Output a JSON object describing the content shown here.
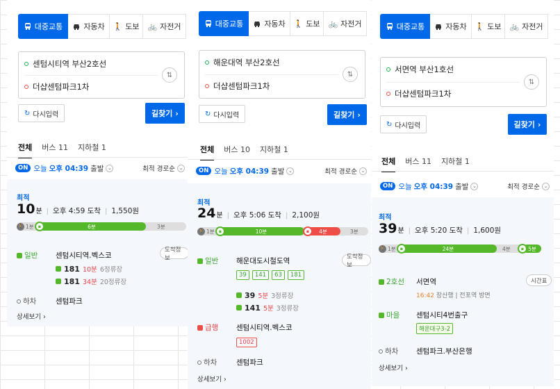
{
  "panels": [
    {
      "modes": [
        "대중교통",
        "자동차",
        "도보",
        "자전거"
      ],
      "start": "센텀시티역 부산2호선",
      "end": "더샵센텀파크1차",
      "reset": "다시입력",
      "go": "길찾기",
      "tabs": [
        "전체",
        "버스 11",
        "지하철 1"
      ],
      "on": "ON",
      "today": "오늘",
      "depart_time": "오후 04:39",
      "depart_suffix": "출발",
      "sort": "최적 경로순",
      "best": "최적",
      "minutes": "10",
      "unit": "분",
      "arrive": "오후 4:59 도착",
      "fare": "1,550원",
      "bar": {
        "walk1": "1분",
        "seg1": "6분",
        "walk2": "3분"
      },
      "steps": [
        {
          "tag": "일반",
          "station": "센텀시티역.벡스코",
          "btn": "도착정보"
        }
      ],
      "buses": [
        {
          "num": "181",
          "min": "10분",
          "stops": "6정류장"
        },
        {
          "num": "181",
          "min": "34분",
          "stops": "20정류장"
        }
      ],
      "alight_label": "하차",
      "alight_station": "센텀파크",
      "more": "상세보기"
    },
    {
      "modes": [
        "대중교통",
        "자동차",
        "도보",
        "자전거"
      ],
      "start": "해운대역 부산2호선",
      "end": "더샵센텀파크1차",
      "reset": "다시입력",
      "go": "길찾기",
      "tabs": [
        "전체",
        "버스 10",
        "지하철 1"
      ],
      "on": "ON",
      "today": "오늘",
      "depart_time": "오후 04:39",
      "depart_suffix": "출발",
      "sort": "최적 경로순",
      "best": "최적",
      "minutes": "24",
      "unit": "분",
      "arrive": "오후 5:06 도착",
      "fare": "2,100원",
      "bar": {
        "walk1": "1분",
        "seg1": "10분",
        "seg2": "4분",
        "walk2": "3분"
      },
      "steps": [
        {
          "tag": "일반",
          "station": "해운대도시철도역",
          "btn": "도착정보",
          "chips": [
            "39",
            "141",
            "63",
            "181"
          ]
        },
        {
          "tag": "급행",
          "station": "센텀시티역.벡스코",
          "chips": [
            "1002"
          ]
        }
      ],
      "buses": [
        {
          "num": "39",
          "min": "5분",
          "stops": "3정류장"
        },
        {
          "num": "141",
          "min": "5분",
          "stops": "3정류장"
        }
      ],
      "alight_label": "하차",
      "alight_station": "센텀파크",
      "more": "상세보기"
    },
    {
      "modes": [
        "대중교통",
        "자동차",
        "도보",
        "자전거"
      ],
      "start": "서면역 부산1호선",
      "end": "더샵센텀파크1차",
      "reset": "다시입력",
      "go": "길찾기",
      "tabs": [
        "전체",
        "버스 11",
        "지하철 1"
      ],
      "on": "ON",
      "today": "오늘",
      "depart_time": "오후 04:39",
      "depart_suffix": "출발",
      "sort": "최적 경로순",
      "best": "최적",
      "minutes": "39",
      "unit": "분",
      "arrive": "오후 5:20 도착",
      "fare": "1,600원",
      "bar": {
        "walk1": "1분",
        "seg1": "24분",
        "walk2": "4분",
        "seg2": "5분"
      },
      "steps": [
        {
          "tag": "2호선",
          "station": "서면역",
          "btn": "시간표",
          "note_time": "16:42",
          "note_rest": "장산행 | 전포역 방면"
        },
        {
          "tag": "마을",
          "station": "센텀시티4번출구",
          "chips": [
            "해운대구3-2"
          ]
        }
      ],
      "alight_label": "하차",
      "alight_station": "센텀파크.부산은행",
      "more": "상세보기"
    }
  ]
}
